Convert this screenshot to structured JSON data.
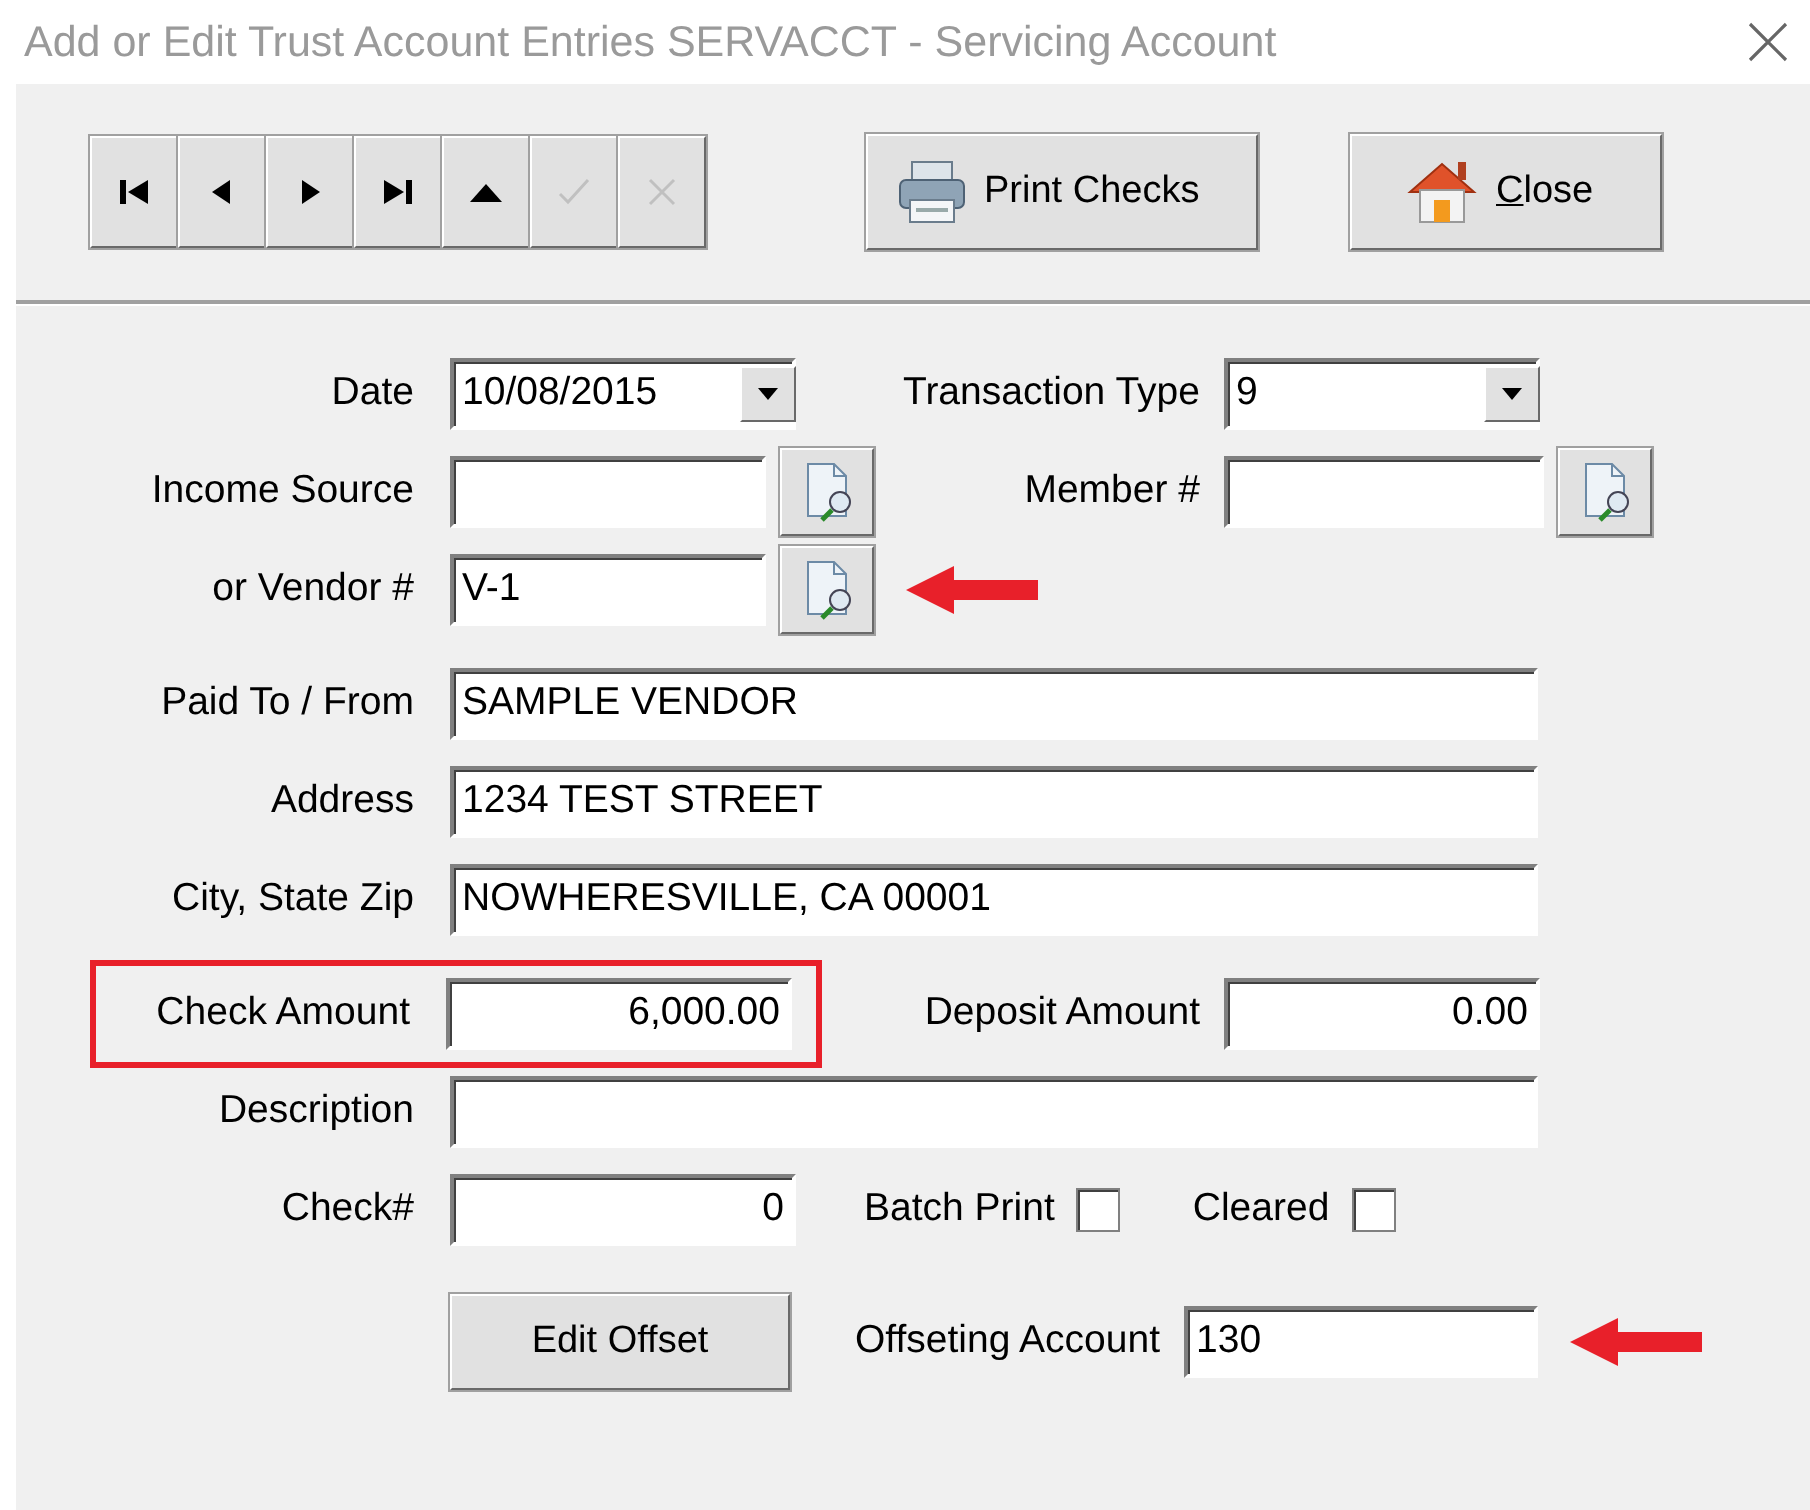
{
  "window": {
    "title": "Add or Edit Trust Account Entries  SERVACCT - Servicing Account"
  },
  "toolbar": {
    "nav_buttons": [
      {
        "kind": "first",
        "disabled": false
      },
      {
        "kind": "previous",
        "disabled": false
      },
      {
        "kind": "next",
        "disabled": false
      },
      {
        "kind": "last",
        "disabled": false
      },
      {
        "kind": "up",
        "disabled": false
      },
      {
        "kind": "save",
        "disabled": true
      },
      {
        "kind": "cancel",
        "disabled": true
      }
    ],
    "print_button": {
      "label": "Print Checks"
    },
    "close_button": {
      "label": "Close",
      "mnemonic_underlined": true
    }
  },
  "form_rows": [
    [
      {
        "kind": "field",
        "label": "Date",
        "value": "10/08/2015",
        "dropdown": true
      },
      {
        "kind": "field",
        "label": "Transaction Type",
        "value": "9",
        "dropdown": true
      }
    ],
    [
      {
        "kind": "field",
        "label": "Income Source",
        "lookup": true
      },
      {
        "kind": "field",
        "label": "Member #",
        "lookup": true
      }
    ],
    [
      {
        "kind": "field",
        "label": "or Vendor #",
        "value": "V-1",
        "lookup": true,
        "arrow": true
      }
    ],
    [
      {
        "kind": "wide",
        "label": "Paid To / From",
        "value": "SAMPLE VENDOR"
      }
    ],
    [
      {
        "kind": "wide",
        "label": "Address",
        "value": "1234 TEST STREET"
      }
    ],
    [
      {
        "kind": "wide",
        "label": "City, State Zip",
        "value": "NOWHERESVILLE, CA 00001"
      }
    ],
    [
      {
        "kind": "field",
        "label": "Check Amount",
        "value": "6,000.00",
        "numeric": true,
        "highlight": true
      },
      {
        "kind": "field",
        "label": "Deposit Amount",
        "value": "0.00",
        "numeric": true
      }
    ],
    [
      {
        "kind": "wide",
        "label": "Description"
      }
    ],
    [
      {
        "kind": "field",
        "label": "Check#",
        "value": "0",
        "numeric": true
      },
      {
        "kind": "checkbox",
        "label": "Batch Print",
        "checked": false
      },
      {
        "kind": "checkbox",
        "label": "Cleared",
        "checked": false
      }
    ],
    [
      {
        "kind": "button",
        "label": "Edit Offset"
      },
      {
        "kind": "field",
        "label": "Offseting Account",
        "value": "130",
        "arrow": true
      }
    ]
  ]
}
